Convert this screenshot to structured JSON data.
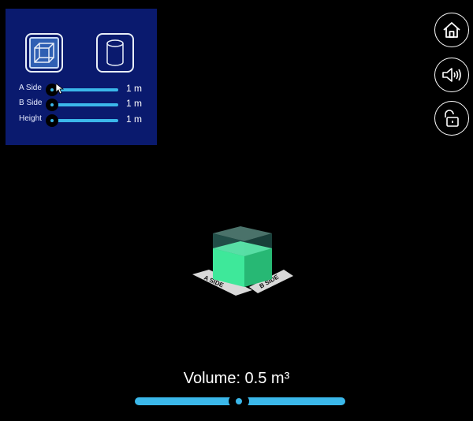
{
  "panel": {
    "shape_buttons": [
      {
        "name": "cube",
        "icon": "cube-icon",
        "selected": true
      },
      {
        "name": "cylinder",
        "icon": "cylinder-icon",
        "selected": false
      }
    ],
    "sliders": [
      {
        "label": "A Side",
        "value": "1 m",
        "position": 0
      },
      {
        "label": "B Side",
        "value": "1 m",
        "position": 0
      },
      {
        "label": "Height",
        "value": "1 m",
        "position": 0
      }
    ]
  },
  "side_buttons": [
    {
      "icon": "home-icon"
    },
    {
      "icon": "speaker-icon"
    },
    {
      "icon": "unlock-icon"
    }
  ],
  "scene": {
    "label_a": "A SIDE",
    "label_b": "B SIDE"
  },
  "volume": {
    "text": "Volume: 0.5 m³",
    "slider_position": 0.5
  },
  "colors": {
    "panel_bg": "#0a1a6e",
    "accent": "#3bb8ea",
    "fill_green": "#3ee89a"
  }
}
